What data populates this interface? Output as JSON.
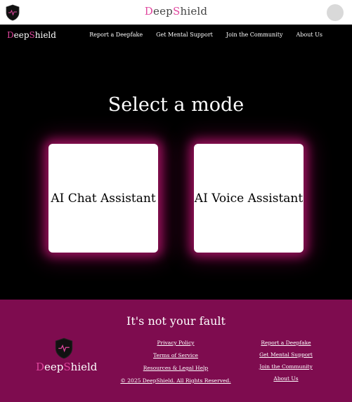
{
  "topbar": {
    "brand_first": "D",
    "brand_mid": "eep",
    "brand_s": "S",
    "brand_rest": "hield"
  },
  "nav": {
    "logo_first": "D",
    "logo_mid": "eep",
    "logo_s": "S",
    "logo_rest": "hield",
    "links": [
      "Report a Deepfake",
      "Get Mental Support",
      "Join the Community",
      "About Us"
    ]
  },
  "main": {
    "title": "Select a mode",
    "cards": [
      "AI Chat Assistant",
      "AI Voice Assistant"
    ]
  },
  "footer": {
    "tagline": "It's not your fault",
    "brand_first": "D",
    "brand_mid": "eep",
    "brand_s": "S",
    "brand_rest": "hield",
    "col1": [
      "Privacy Policy",
      "Terms of Service",
      "Resources & Legal Help",
      "© 2025 DeepShield. All Rights Reserved."
    ],
    "col2": [
      "Report a Deepfake",
      "Get Mental Support",
      "Join the Community",
      "About Us"
    ]
  },
  "colors": {
    "accent_pink": "#e0479e",
    "footer_bg": "#7e0c4f",
    "glow": "#e91e8c"
  },
  "icons": [
    "shield-logo-icon",
    "avatar"
  ]
}
